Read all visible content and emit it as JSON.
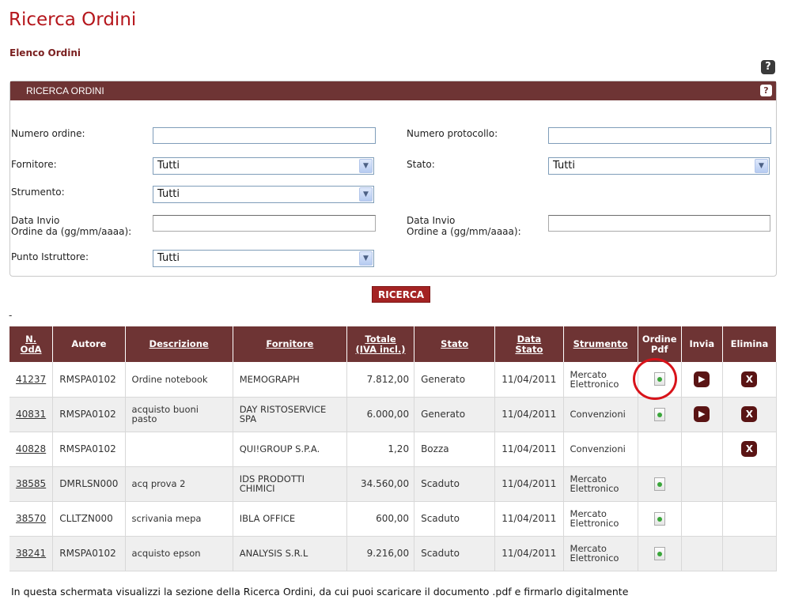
{
  "page": {
    "title": "Ricerca Ordini",
    "subtitle": "Elenco Ordini",
    "help_glyph": "?"
  },
  "search": {
    "header": "RICERCA ORDINI",
    "help_glyph": "?",
    "labels": {
      "numero_ordine": "Numero ordine:",
      "numero_protocollo": "Numero protocollo:",
      "fornitore": "Fornitore:",
      "stato": "Stato:",
      "strumento": "Strumento:",
      "data_invio_da_1": "Data Invio",
      "data_invio_da_2": "Ordine da (gg/mm/aaaa):",
      "data_invio_a_1": "Data Invio",
      "data_invio_a_2": "Ordine a (gg/mm/aaaa):",
      "punto_istruttore": "Punto Istruttore:"
    },
    "values": {
      "numero_ordine": "",
      "numero_protocollo": "",
      "fornitore": "Tutti",
      "stato": "Tutti",
      "strumento": "Tutti",
      "data_da": "",
      "data_a": "",
      "punto_istruttore": "Tutti"
    },
    "button": "RICERCA"
  },
  "dash": "-",
  "table": {
    "headers": {
      "n_oda_1": "N.",
      "n_oda_2": "OdA",
      "autore": "Autore",
      "descrizione": "Descrizione",
      "fornitore": "Fornitore",
      "totale_1": "Totale",
      "totale_2": "(IVA incl.)",
      "stato": "Stato",
      "data_1": "Data",
      "data_2": "Stato",
      "strumento": "Strumento",
      "ordine_pdf_1": "Ordine",
      "ordine_pdf_2": "Pdf",
      "invia": "Invia",
      "elimina": "Elimina"
    },
    "rows": [
      {
        "n": "41237",
        "autore": "RMSPA0102",
        "descrizione": "Ordine notebook",
        "fornitore": "MEMOGRAPH",
        "totale": "7.812,00",
        "stato": "Generato",
        "data": "11/04/2011",
        "strumento": "Mercato Elettronico",
        "pdf": true,
        "invia": true,
        "elimina": true
      },
      {
        "n": "40831",
        "autore": "RMSPA0102",
        "descrizione": "acquisto buoni pasto",
        "fornitore": "DAY RISTOSERVICE SPA",
        "totale": "6.000,00",
        "stato": "Generato",
        "data": "11/04/2011",
        "strumento": "Convenzioni",
        "pdf": true,
        "invia": true,
        "elimina": true
      },
      {
        "n": "40828",
        "autore": "RMSPA0102",
        "descrizione": "",
        "fornitore": "QUI!GROUP S.P.A.",
        "totale": "1,20",
        "stato": "Bozza",
        "data": "11/04/2011",
        "strumento": "Convenzioni",
        "pdf": false,
        "invia": false,
        "elimina": true
      },
      {
        "n": "38585",
        "autore": "DMRLSN000",
        "descrizione": "acq prova 2",
        "fornitore": "IDS PRODOTTI CHIMICI",
        "totale": "34.560,00",
        "stato": "Scaduto",
        "data": "11/04/2011",
        "strumento": "Mercato Elettronico",
        "pdf": true,
        "invia": false,
        "elimina": false
      },
      {
        "n": "38570",
        "autore": "CLLTZN000",
        "descrizione": "scrivania mepa",
        "fornitore": "IBLA OFFICE",
        "totale": "600,00",
        "stato": "Scaduto",
        "data": "11/04/2011",
        "strumento": "Mercato Elettronico",
        "pdf": true,
        "invia": false,
        "elimina": false
      },
      {
        "n": "38241",
        "autore": "RMSPA0102",
        "descrizione": "acquisto epson",
        "fornitore": "ANALYSIS S.R.L",
        "totale": "9.216,00",
        "stato": "Scaduto",
        "data": "11/04/2011",
        "strumento": "Mercato Elettronico",
        "pdf": true,
        "invia": false,
        "elimina": false
      }
    ]
  },
  "icons": {
    "pdf": "pdf-document-icon",
    "invia": "send-play-icon",
    "elimina": "delete-x-icon",
    "help": "help-question-icon"
  },
  "colors": {
    "brand_red": "#b5161c",
    "header_brown": "#6e3434",
    "button_red": "#a42323",
    "highlight": "#d8131a"
  },
  "caption": "In questa schermata visualizzi la sezione della Ricerca Ordini, da cui puoi scaricare il documento .pdf e firmarlo digitalmente"
}
